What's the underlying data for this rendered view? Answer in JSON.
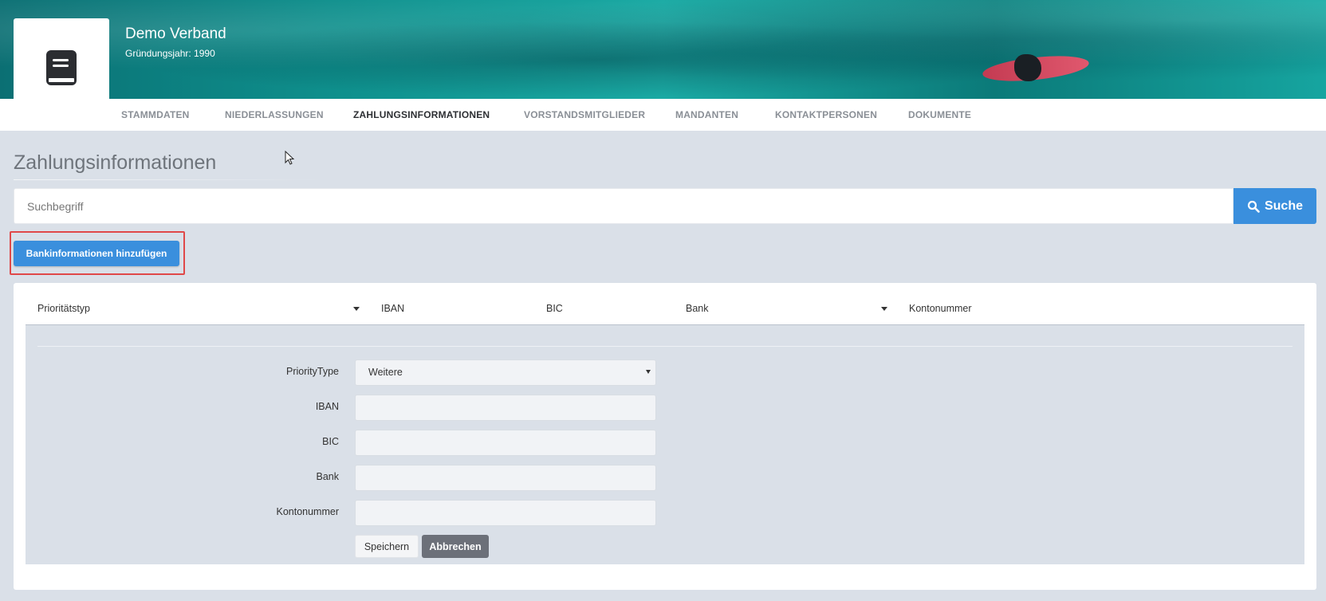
{
  "header": {
    "org_name": "Demo Verband",
    "founding_year": "Gründungsjahr: 1990",
    "logo_icon": "book-icon"
  },
  "tabs": [
    {
      "label": "STAMMDATEN",
      "active": false
    },
    {
      "label": "NIEDERLASSUNGEN",
      "active": false
    },
    {
      "label": "ZAHLUNGSINFORMATIONEN",
      "active": true
    },
    {
      "label": "VORSTANDSMITGLIEDER",
      "active": false
    },
    {
      "label": "MANDANTEN",
      "active": false
    },
    {
      "label": "KONTAKTPERSONEN",
      "active": false
    },
    {
      "label": "DOKUMENTE",
      "active": false
    }
  ],
  "page": {
    "title": "Zahlungsinformationen"
  },
  "search": {
    "placeholder": "Suchbegriff",
    "value": "",
    "button_label": "Suche",
    "button_icon": "search-icon"
  },
  "add_button_label": "Bankinformationen hinzufügen",
  "table": {
    "columns": [
      "Prioritätstyp",
      "IBAN",
      "BIC",
      "Bank",
      "Kontonummer"
    ]
  },
  "form": {
    "priority_label": "PriorityType",
    "priority_value": "Weitere",
    "iban_label": "IBAN",
    "iban_value": "",
    "bic_label": "BIC",
    "bic_value": "",
    "bank_label": "Bank",
    "bank_value": "",
    "account_label": "Kontonummer",
    "account_value": "",
    "save_label": "Speichern",
    "cancel_label": "Abbrechen"
  },
  "colors": {
    "accent": "#3a8fdd",
    "background": "#dae0e8",
    "highlight": "#e04848"
  }
}
